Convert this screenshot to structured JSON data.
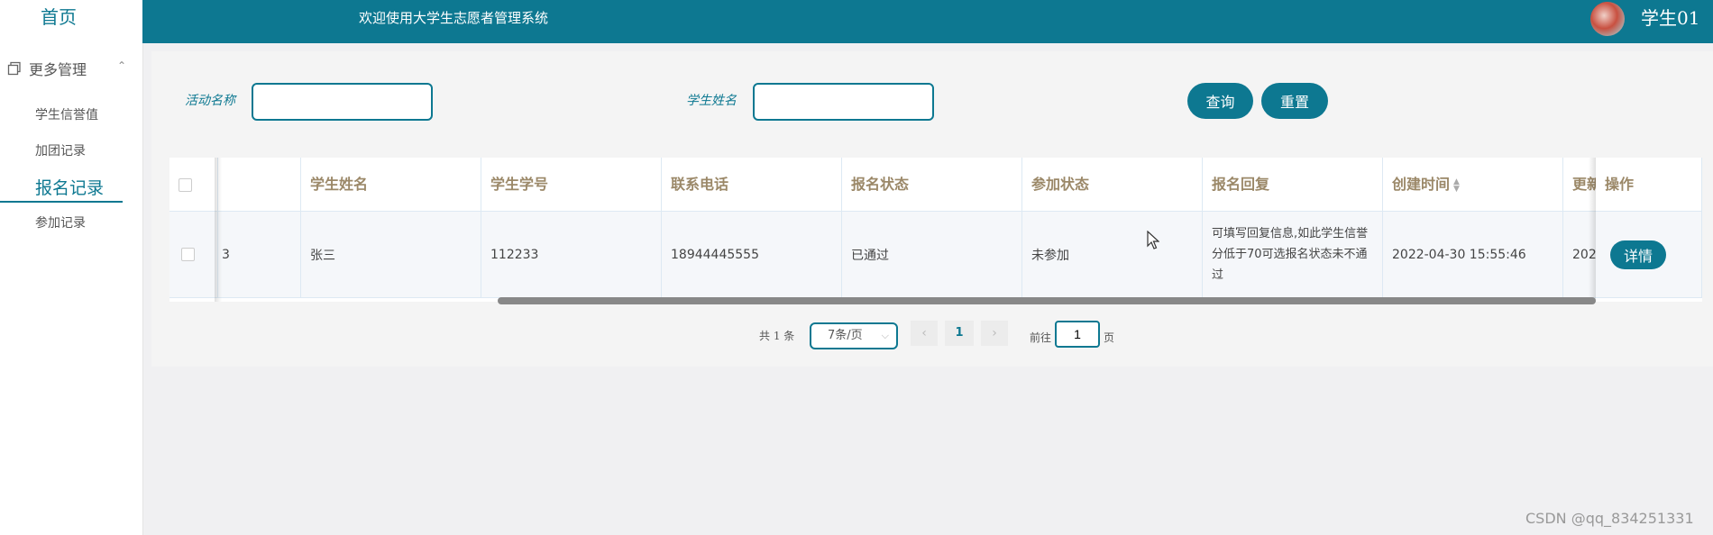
{
  "sidebar": {
    "home": "首页",
    "group_label": "更多管理",
    "items": [
      {
        "label": "学生信誉值"
      },
      {
        "label": "加团记录"
      },
      {
        "label": "报名记录"
      },
      {
        "label": "参加记录"
      }
    ]
  },
  "header": {
    "welcome": "欢迎使用大学生志愿者管理系统",
    "username": "学生01"
  },
  "filters": {
    "activity_label": "活动名称",
    "activity_value": "",
    "student_label": "学生姓名",
    "student_value": "",
    "search_button": "查询",
    "reset_button": "重置"
  },
  "table": {
    "columns": [
      "学生姓名",
      "学生学号",
      "联系电话",
      "报名状态",
      "参加状态",
      "报名回复",
      "创建时间",
      "更新",
      "操作"
    ],
    "rows": [
      {
        "index": "3",
        "name": "张三",
        "student_no": "112233",
        "phone": "18944445555",
        "signup_status": "已通过",
        "join_status": "未参加",
        "reply": "可填写回复信息,如此学生信誉分低于70可选报名状态未不通过",
        "created": "2022-04-30 15:55:46",
        "updated": "202",
        "action": "详情"
      }
    ]
  },
  "pagination": {
    "total": "共 1 条",
    "page_size": "7条/页",
    "current_page": "1",
    "goto_label": "前往",
    "goto_value": "1",
    "page_suffix": "页"
  },
  "watermark": "CSDN @qq_834251331",
  "colors": {
    "accent": "#0d7891",
    "header_text": "#9b8868"
  }
}
